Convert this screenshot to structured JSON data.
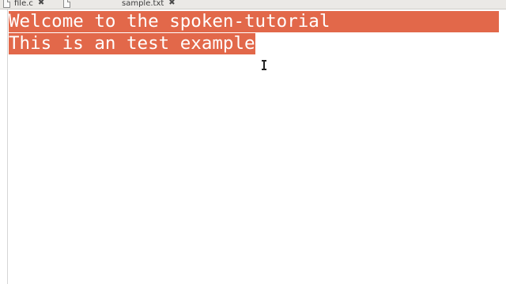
{
  "tabs": [
    {
      "label": "file.c",
      "icon": "text-file-icon",
      "close_icon": "✖"
    },
    {
      "label": "sample.txt",
      "icon": "text-file-icon",
      "close_icon": "✖"
    }
  ],
  "editor": {
    "lines": [
      "Welcome to the spoken-tutorial",
      "This is an test example"
    ],
    "selection_color": "#e2684a",
    "text_color": "#ffffff"
  }
}
